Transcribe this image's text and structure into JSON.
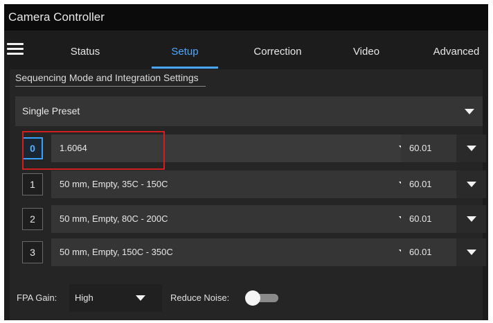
{
  "window": {
    "title": "Camera Controller"
  },
  "tabs": [
    {
      "label": "Status"
    },
    {
      "label": "Setup",
      "active": true
    },
    {
      "label": "Correction"
    },
    {
      "label": "Video"
    },
    {
      "label": "Advanced"
    }
  ],
  "section": {
    "title": "Sequencing Mode and Integration Settings"
  },
  "mode": {
    "selected": "Single Preset"
  },
  "presets": [
    {
      "index": "0",
      "label": "1.6064",
      "rate": "60.01",
      "selected": true
    },
    {
      "index": "1",
      "label": "50 mm, Empty, 35C - 150C",
      "rate": "60.01"
    },
    {
      "index": "2",
      "label": "50 mm, Empty, 80C - 200C",
      "rate": "60.01"
    },
    {
      "index": "3",
      "label": "50 mm, Empty, 150C - 350C",
      "rate": "60.01"
    }
  ],
  "fpa_gain": {
    "label": "FPA Gain:",
    "value": "High"
  },
  "reduce_noise": {
    "label": "Reduce Noise:",
    "on": false
  },
  "colors": {
    "accent": "#4aa7ff",
    "highlight": "#d11f1f",
    "background": "#1c1c1c"
  },
  "icons": [
    "hamburger-menu-icon",
    "chevron-down-icon"
  ]
}
